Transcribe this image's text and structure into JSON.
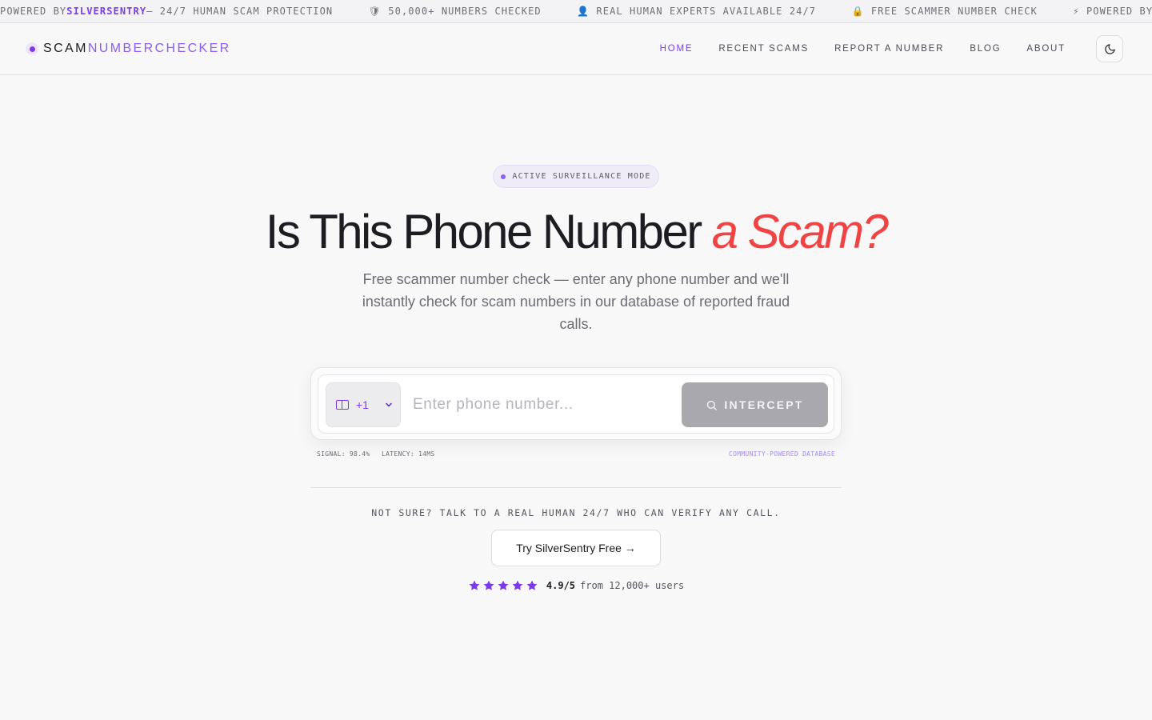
{
  "ticker": {
    "items": [
      {
        "prefix": "POWERED BY ",
        "highlight": "SILVERSENTRY",
        "suffix": " — 24/7 HUMAN SCAM PROTECTION",
        "icon": ""
      },
      {
        "prefix": "",
        "highlight": "",
        "suffix": "50,000+ NUMBERS CHECKED",
        "icon": "🛡"
      },
      {
        "prefix": "",
        "highlight": "",
        "suffix": "REAL HUMAN EXPERTS AVAILABLE 24/7",
        "icon": "👤"
      },
      {
        "prefix": "",
        "highlight": "",
        "suffix": "FREE SCAMMER NUMBER CHECK",
        "icon": "🔒"
      },
      {
        "prefix": "",
        "highlight": "",
        "suffix": "POWERED BY",
        "icon": "⚡"
      }
    ]
  },
  "header": {
    "logo_part1": "SCAM",
    "logo_part2": "NUMBERCHECKER",
    "nav": [
      {
        "label": "HOME",
        "active": true
      },
      {
        "label": "RECENT SCAMS",
        "active": false
      },
      {
        "label": "REPORT A NUMBER",
        "active": false
      },
      {
        "label": "BLOG",
        "active": false
      },
      {
        "label": "ABOUT",
        "active": false
      }
    ],
    "theme_icon": "moon-icon"
  },
  "hero": {
    "badge": "ACTIVE SURVEILLANCE MODE",
    "title_main": "Is This Phone Number ",
    "title_accent": "a Scam?",
    "subtitle": "Free scammer number check — enter any phone number and we'll instantly check for scam numbers in our database of reported fraud calls."
  },
  "search": {
    "country_code": "+1",
    "placeholder": "Enter phone number...",
    "value": "",
    "button_label": "INTERCEPT",
    "signal": "SIGNAL: 98.4%",
    "latency": "LATENCY: 14MS",
    "database_note": "COMMUNITY-POWERED DATABASE"
  },
  "cta": {
    "text": "NOT SURE? TALK TO A REAL HUMAN 24/7 WHO CAN VERIFY ANY CALL.",
    "button": "Try SilverSentry Free →",
    "rating_score": "4.9/5",
    "rating_from": "from 12,000+ users",
    "stars": 5
  },
  "colors": {
    "accent": "#7c3aed",
    "danger": "#ef4444",
    "button_disabled": "#a9a9ad"
  }
}
